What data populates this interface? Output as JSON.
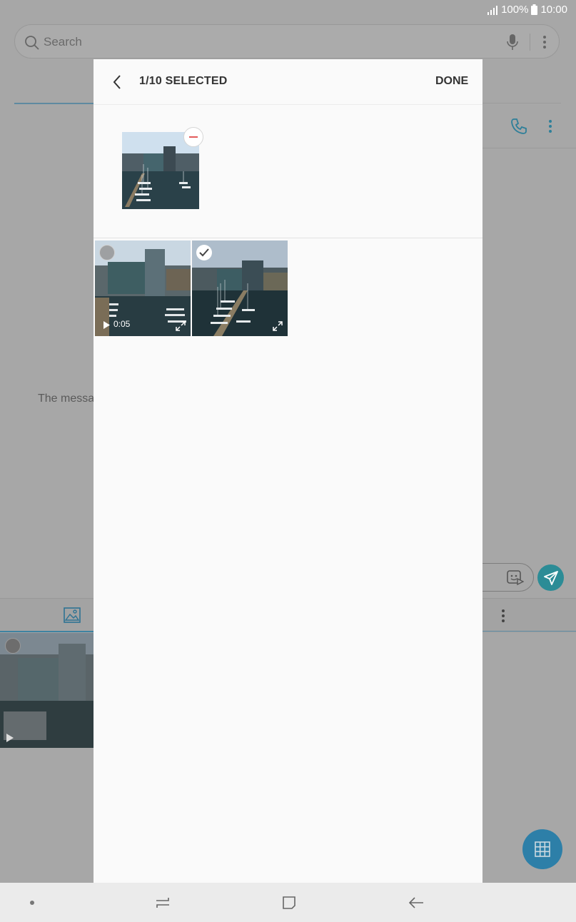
{
  "status_bar": {
    "battery": "100%",
    "time": "10:00"
  },
  "search": {
    "placeholder": "Search"
  },
  "background": {
    "message_text": "The messa"
  },
  "modal": {
    "title": "1/10 SELECTED",
    "done_label": "DONE",
    "grid": [
      {
        "type": "video",
        "duration": "0:05",
        "selected": false
      },
      {
        "type": "image",
        "selected": true
      }
    ]
  },
  "colors": {
    "accent": "#2d7fa8",
    "send": "#2c8c96",
    "remove": "#e25b5b"
  }
}
